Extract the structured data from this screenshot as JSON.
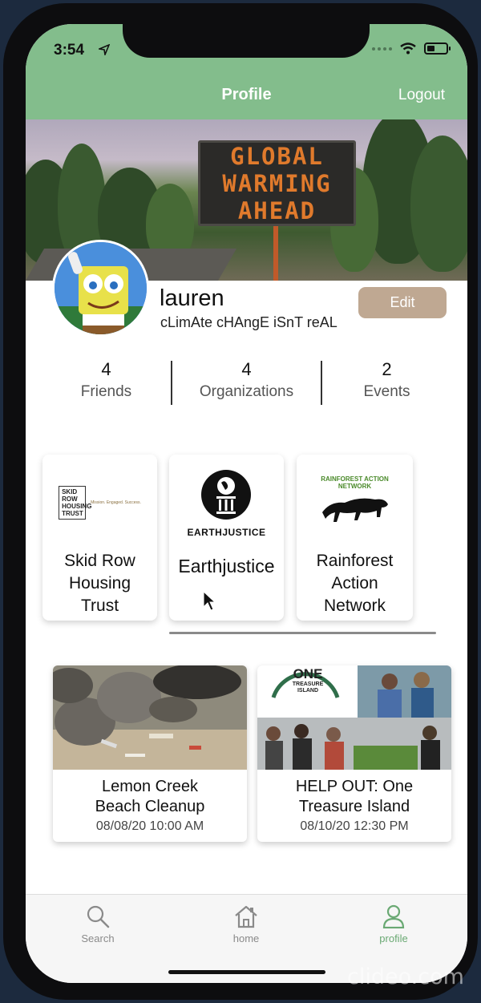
{
  "status": {
    "time": "3:54"
  },
  "header": {
    "title": "Profile",
    "logout_label": "Logout"
  },
  "cover": {
    "sign_lines": [
      "GLOBAL",
      "WARMING",
      "AHEAD"
    ]
  },
  "profile": {
    "username": "lauren",
    "bio": "cLimAte cHAngE iSnT reAL",
    "edit_label": "Edit"
  },
  "stats": [
    {
      "count": "4",
      "label": "Friends"
    },
    {
      "count": "4",
      "label": "Organizations"
    },
    {
      "count": "2",
      "label": "Events"
    }
  ],
  "organizations": [
    {
      "name": "Skid Row Housing Trust",
      "logo_text": "SKID ROW HOUSING TRUST",
      "logo_tagline": "Mission. Engaged. Success."
    },
    {
      "name": "Earthjustice",
      "logo_text": "EARTHJUSTICE"
    },
    {
      "name": "Rainforest Action Network",
      "logo_text": "RAINFOREST ACTION NETWORK"
    }
  ],
  "events": [
    {
      "title": "Lemon Creek Beach Cleanup",
      "date": "08/08/20 10:00 AM"
    },
    {
      "title": "HELP OUT: One Treasure Island",
      "date": "08/10/20 12:30 PM",
      "logo_text_1": "ONE",
      "logo_text_2": "TREASURE ISLAND"
    }
  ],
  "tabbar": {
    "items": [
      {
        "label": "Search",
        "icon": "search-icon"
      },
      {
        "label": "home",
        "icon": "home-icon"
      },
      {
        "label": "profile",
        "icon": "person-icon",
        "active": true
      }
    ]
  },
  "colors": {
    "header_green": "#83bd8c",
    "edit_button": "#bfa892",
    "active_tab": "#6aa973"
  },
  "watermark": "clideo.com"
}
